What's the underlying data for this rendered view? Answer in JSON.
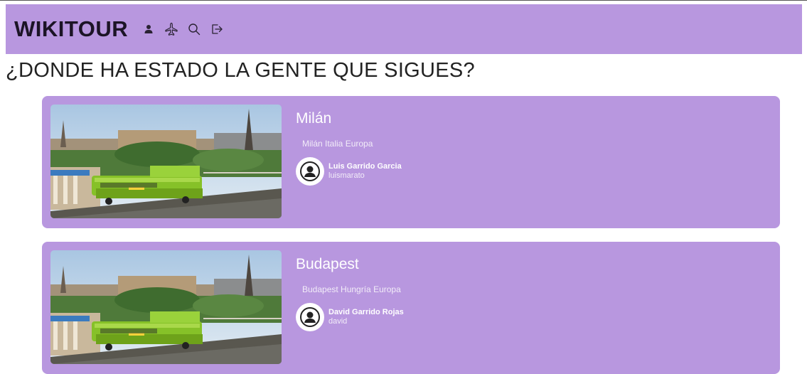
{
  "header": {
    "brand": "WIKITOUR",
    "icons": [
      "user-icon",
      "plane-icon",
      "search-icon",
      "logout-icon"
    ],
    "background_color": "#b897df"
  },
  "page": {
    "title": "¿DONDE HA ESTADO LA GENTE QUE SIGUES?"
  },
  "trips": [
    {
      "title": "Milán",
      "location": "Milán Italia Europa",
      "author_name": "Luis Garrido Garcia",
      "author_username": "luismarato"
    },
    {
      "title": "Budapest",
      "location": "Budapest Hungría Europa",
      "author_name": "David Garrido Rojas",
      "author_username": "david"
    }
  ]
}
